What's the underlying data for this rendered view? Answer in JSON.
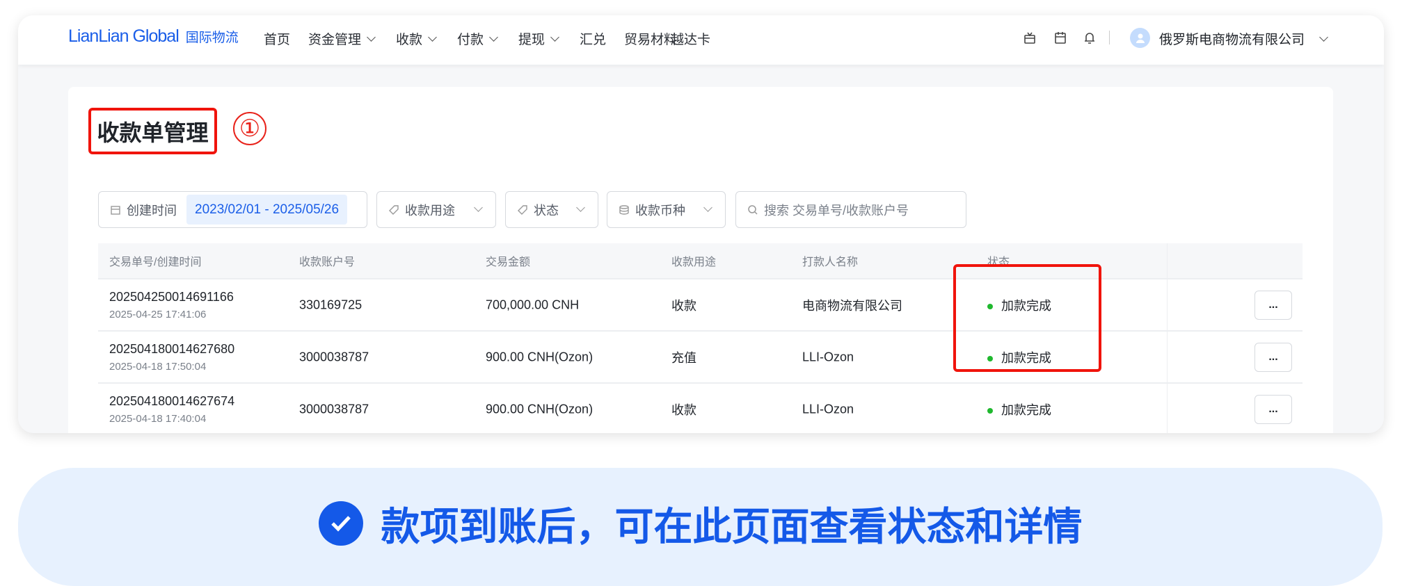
{
  "header": {
    "logo": "LianLian Global",
    "logo_sub": "国际物流",
    "nav": [
      {
        "label": "首页",
        "dropdown": false
      },
      {
        "label": "资金管理",
        "dropdown": true
      },
      {
        "label": "收款",
        "dropdown": true
      },
      {
        "label": "付款",
        "dropdown": true
      },
      {
        "label": "提现",
        "dropdown": true
      },
      {
        "label": "汇兑",
        "dropdown": false
      },
      {
        "label": "贸易材料",
        "dropdown": false
      },
      {
        "label": "越达卡",
        "dropdown": false
      }
    ],
    "user": "俄罗斯电商物流有限公司"
  },
  "page": {
    "title": "收款单管理",
    "step": "①"
  },
  "filters": {
    "date_label": "创建时间",
    "date_value": "2023/02/01 - 2025/05/26",
    "purpose": "收款用途",
    "status": "状态",
    "currency": "收款币种",
    "search_placeholder": "搜索 交易单号/收款账户号"
  },
  "table": {
    "columns": [
      "交易单号/创建时间",
      "收款账户号",
      "交易金额",
      "收款用途",
      "打款人名称",
      "状态"
    ],
    "rows": [
      {
        "id": "202504250014691166",
        "time": "2025-04-25 17:41:06",
        "account": "330169725",
        "amount": "700,000.00 CNH",
        "purpose": "收款",
        "payer": "电商物流有限公司",
        "status": "加款完成",
        "more": "..."
      },
      {
        "id": "202504180014627680",
        "time": "2025-04-18 17:50:04",
        "account": "3000038787",
        "amount": "900.00 CNH(Ozon)",
        "purpose": "充值",
        "payer": "LLI-Ozon",
        "status": "加款完成",
        "more": "..."
      },
      {
        "id": "202504180014627674",
        "time": "2025-04-18 17:40:04",
        "account": "3000038787",
        "amount": "900.00 CNH(Ozon)",
        "purpose": "收款",
        "payer": "LLI-Ozon",
        "status": "加款完成",
        "more": "..."
      }
    ]
  },
  "banner": {
    "text": "款项到账后，可在此页面查看状态和详情"
  },
  "colors": {
    "brand": "#1a5ee8",
    "highlight": "#f0140c",
    "status_ok": "#1fb82e",
    "banner_bg": "#e7f1fe"
  }
}
